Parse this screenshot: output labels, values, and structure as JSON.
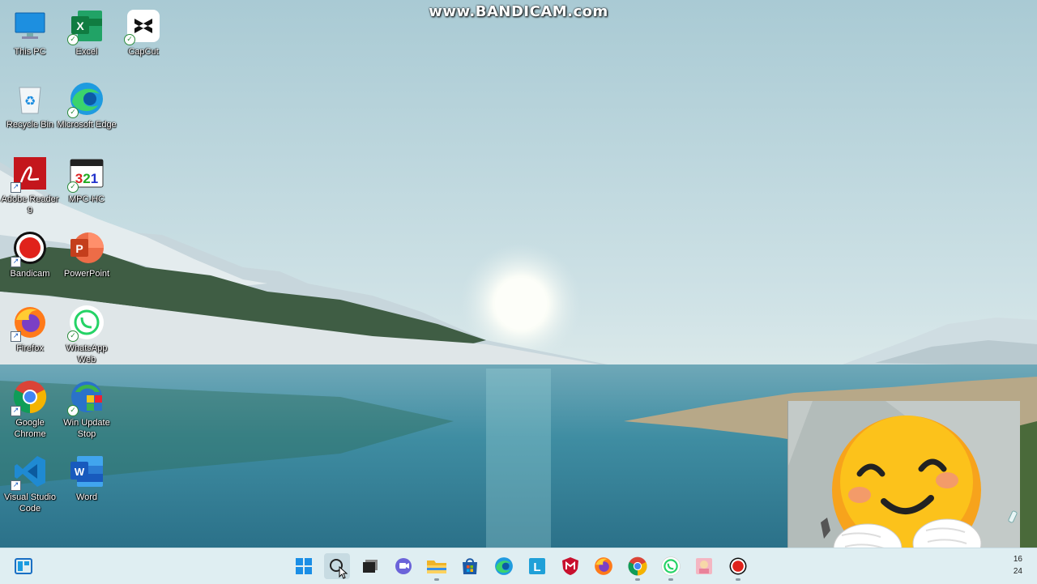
{
  "watermark": "www.BANDICAM.com",
  "desktop_icons": [
    {
      "label": "This PC",
      "icon": "monitor-icon"
    },
    {
      "label": "Excel",
      "icon": "excel-icon"
    },
    {
      "label": "CapCut",
      "icon": "capcut-icon"
    },
    {
      "label": "Recycle Bin",
      "icon": "recycle-bin-icon"
    },
    {
      "label": "Microsoft Edge",
      "icon": "edge-icon"
    },
    {
      "label": "Adobe Reader 9",
      "icon": "adobe-reader-icon"
    },
    {
      "label": "MPC-HC",
      "icon": "mpc-hc-icon"
    },
    {
      "label": "Bandicam",
      "icon": "bandicam-icon"
    },
    {
      "label": "PowerPoint",
      "icon": "powerpoint-icon"
    },
    {
      "label": "Firefox",
      "icon": "firefox-icon"
    },
    {
      "label": "WhatsApp Web",
      "icon": "whatsapp-icon"
    },
    {
      "label": "Google Chrome",
      "icon": "chrome-icon"
    },
    {
      "label": "Win Update Stop",
      "icon": "win-update-stop-icon"
    },
    {
      "label": "Visual Studio Code",
      "icon": "vscode-icon"
    },
    {
      "label": "Word",
      "icon": "word-icon"
    }
  ],
  "taskbar": {
    "apps": [
      "widgets-icon",
      "start-icon",
      "search-icon",
      "task-view-icon",
      "teams-chat-icon",
      "file-explorer-icon",
      "microsoft-store-icon",
      "edge-icon",
      "l-app-icon",
      "mcafee-icon",
      "firefox-icon",
      "chrome-icon",
      "whatsapp-icon",
      "photo-app-icon",
      "bandicam-icon"
    ],
    "clock_partial_1": "16",
    "clock_partial_2": "24"
  },
  "webcam_overlay": "hugging-face-emoji"
}
